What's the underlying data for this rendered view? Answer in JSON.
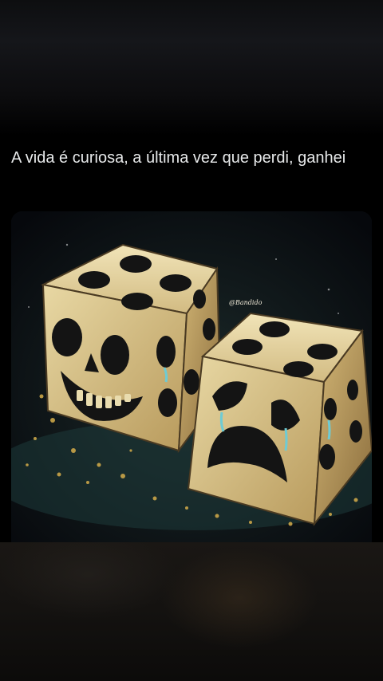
{
  "post": {
    "text": "A vida é curiosa, a última vez que perdi, ganhei",
    "image_watermark": "@Bandido"
  },
  "colors": {
    "background": "#000000",
    "text": "#e7e9ea",
    "die_face": "#d9c28a",
    "die_shadow": "#6b5633"
  }
}
